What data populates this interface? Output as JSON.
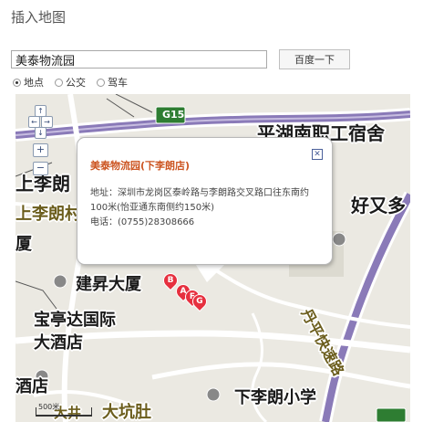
{
  "dialog": {
    "title": "插入地图"
  },
  "search": {
    "value": "美泰物流园",
    "button_label": "百度一下"
  },
  "modes": [
    {
      "label": "地点",
      "selected": true
    },
    {
      "label": "公交",
      "selected": false
    },
    {
      "label": "驾车",
      "selected": false
    }
  ],
  "map": {
    "labels": {
      "road_g15": "G15",
      "pinghu_dorm": "平湖南职工宿舍",
      "shanglilang": "上李朗",
      "shanglilang2": "上李朗村",
      "hao_you_duo": "好又多",
      "sha": "厦",
      "jiansheng": "建昇大厦",
      "baotingda1": "宝亭达国际",
      "baotingda2": "大酒店",
      "jiudian": "酒店",
      "danping": "丹平快速路",
      "xialilang_school": "下李朗小学",
      "dakengzhu": "大坑肚",
      "dajing": "大井",
      "scale": "500米"
    },
    "markers": [
      "B",
      "A",
      "F",
      "G"
    ],
    "controls": {
      "up": "↑",
      "left": "←",
      "right": "→",
      "down": "↓",
      "zoom_in": "+",
      "zoom_out": "−"
    }
  },
  "popup": {
    "title": "美泰物流园(下李朗店)",
    "close_icon": "close-icon",
    "address": "地址：深圳市龙岗区泰岭路与李朗路交叉路口往东南约100米(怡亚通东南侧约150米)",
    "phone": "电话：(0755)28308666"
  },
  "colors": {
    "popup_title": "#cc5522",
    "expressway": "#8a7ab8",
    "marker": "#e6303f",
    "g15_sign": "#2e7d32"
  }
}
